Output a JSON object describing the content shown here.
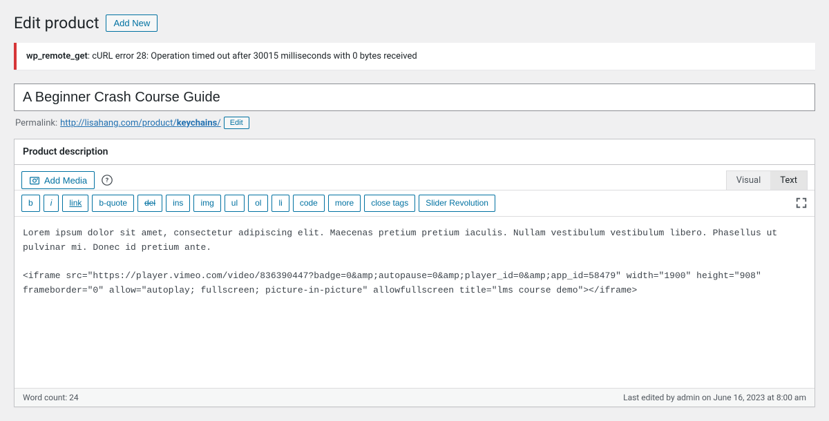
{
  "header": {
    "title": "Edit product",
    "add_new": "Add New"
  },
  "error": {
    "prefix": "wp_remote_get",
    "msg": ": cURL error 28: Operation timed out after 30015 milliseconds with 0 bytes received"
  },
  "title_field": {
    "value": "A Beginner Crash Course Guide"
  },
  "permalink": {
    "label": "Permalink:",
    "url_base": "http://lisahang.com/product/",
    "slug": "keychains",
    "trail": "/",
    "edit": "Edit"
  },
  "panel": {
    "title": "Product description"
  },
  "add_media": "Add Media",
  "tabs": {
    "visual": "Visual",
    "text": "Text"
  },
  "quicktags": {
    "b": "b",
    "i": "i",
    "link": "link",
    "bquote": "b-quote",
    "del": "del",
    "ins": "ins",
    "img": "img",
    "ul": "ul",
    "ol": "ol",
    "li": "li",
    "code": "code",
    "more": "more",
    "close": "close tags",
    "slider": "Slider Revolution"
  },
  "editor": {
    "content": "Lorem ipsum dolor sit amet, consectetur adipiscing elit. Maecenas pretium pretium iaculis. Nullam vestibulum vestibulum libero. Phasellus ut pulvinar mi. Donec id pretium ante.\n\n<iframe src=\"https://player.vimeo.com/video/836390447?badge=0&amp;autopause=0&amp;player_id=0&amp;app_id=58479\" width=\"1900\" height=\"908\" frameborder=\"0\" allow=\"autoplay; fullscreen; picture-in-picture\" allowfullscreen title=\"lms course demo\"></iframe>"
  },
  "status": {
    "wordcount": "Word count: 24",
    "last_edit": "Last edited by admin on June 16, 2023 at 8:00 am"
  }
}
